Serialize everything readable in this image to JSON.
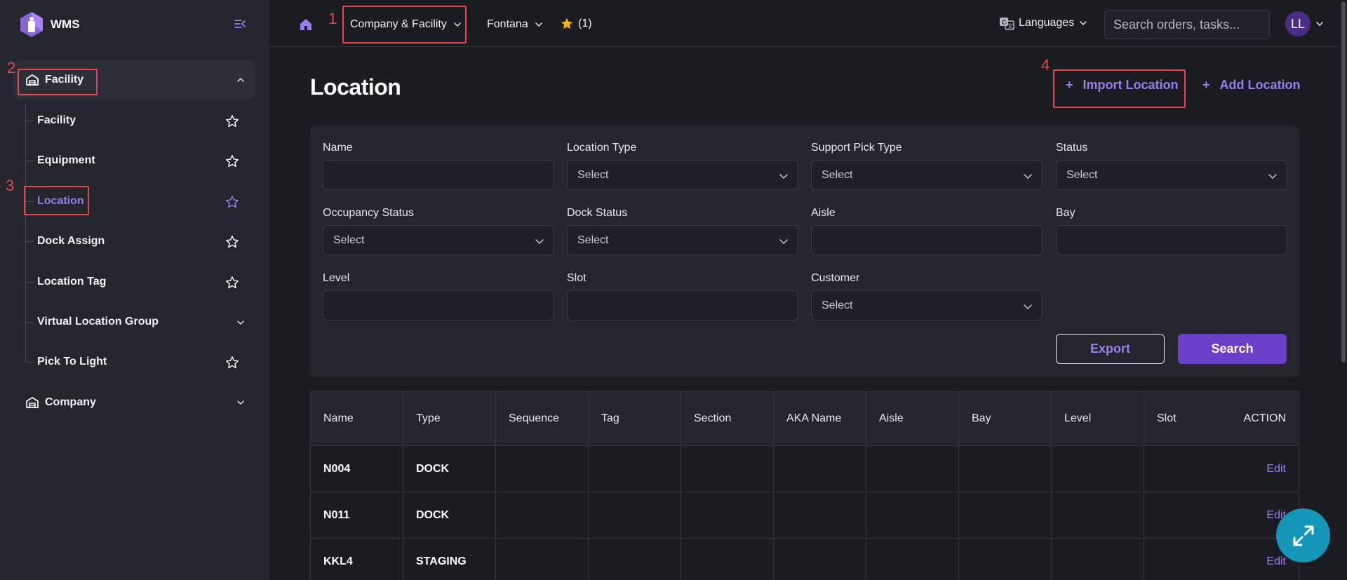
{
  "app": {
    "name": "WMS"
  },
  "header": {
    "company_facility_label": "Company & Facility",
    "facility_name": "Fontana",
    "favorites_count": "(1)",
    "languages_label": "Languages",
    "search_placeholder": "Search orders, tasks...",
    "avatar_initials": "LL"
  },
  "sidebar": {
    "groups": [
      {
        "label": "Facility",
        "expanded": true,
        "items": [
          {
            "label": "Facility",
            "icon": "star-icon"
          },
          {
            "label": "Equipment",
            "icon": "star-icon"
          },
          {
            "label": "Location",
            "icon": "star-icon",
            "active": true
          },
          {
            "label": "Dock Assign",
            "icon": "star-icon"
          },
          {
            "label": "Location Tag",
            "icon": "star-icon"
          },
          {
            "label": "Virtual Location Group",
            "icon": "chevron-down-icon"
          },
          {
            "label": "Pick To Light",
            "icon": "star-icon"
          }
        ]
      },
      {
        "label": "Company",
        "expanded": false
      }
    ]
  },
  "annotations": [
    "1",
    "2",
    "3",
    "4"
  ],
  "page": {
    "title": "Location",
    "import_label": "Import Location",
    "add_label": "Add Location"
  },
  "filters": {
    "name": {
      "label": "Name",
      "value": ""
    },
    "location_type": {
      "label": "Location Type",
      "value": "Select"
    },
    "support_pick_type": {
      "label": "Support Pick Type",
      "value": "Select"
    },
    "status": {
      "label": "Status",
      "value": "Select"
    },
    "occupancy_status": {
      "label": "Occupancy Status",
      "value": "Select"
    },
    "dock_status": {
      "label": "Dock Status",
      "value": "Select"
    },
    "aisle": {
      "label": "Aisle",
      "value": ""
    },
    "bay": {
      "label": "Bay",
      "value": ""
    },
    "level": {
      "label": "Level",
      "value": ""
    },
    "slot": {
      "label": "Slot",
      "value": ""
    },
    "customer": {
      "label": "Customer",
      "value": "Select"
    },
    "export_label": "Export",
    "search_label": "Search"
  },
  "table": {
    "columns": [
      "Name",
      "Type",
      "Sequence",
      "Tag",
      "Section",
      "AKA Name",
      "Aisle",
      "Bay",
      "Level",
      "Slot",
      "ACTION"
    ],
    "rows": [
      {
        "name": "N004",
        "type": "DOCK",
        "action": "Edit"
      },
      {
        "name": "N011",
        "type": "DOCK",
        "action": "Edit"
      },
      {
        "name": "KKL4",
        "type": "STAGING",
        "action": "Edit"
      }
    ]
  },
  "colors": {
    "accent": "#9d7cf0",
    "primary_button": "#6b3fc9",
    "annotation_red": "#e54848",
    "fab": "#1496b8",
    "star_fav": "#f5b50a"
  }
}
